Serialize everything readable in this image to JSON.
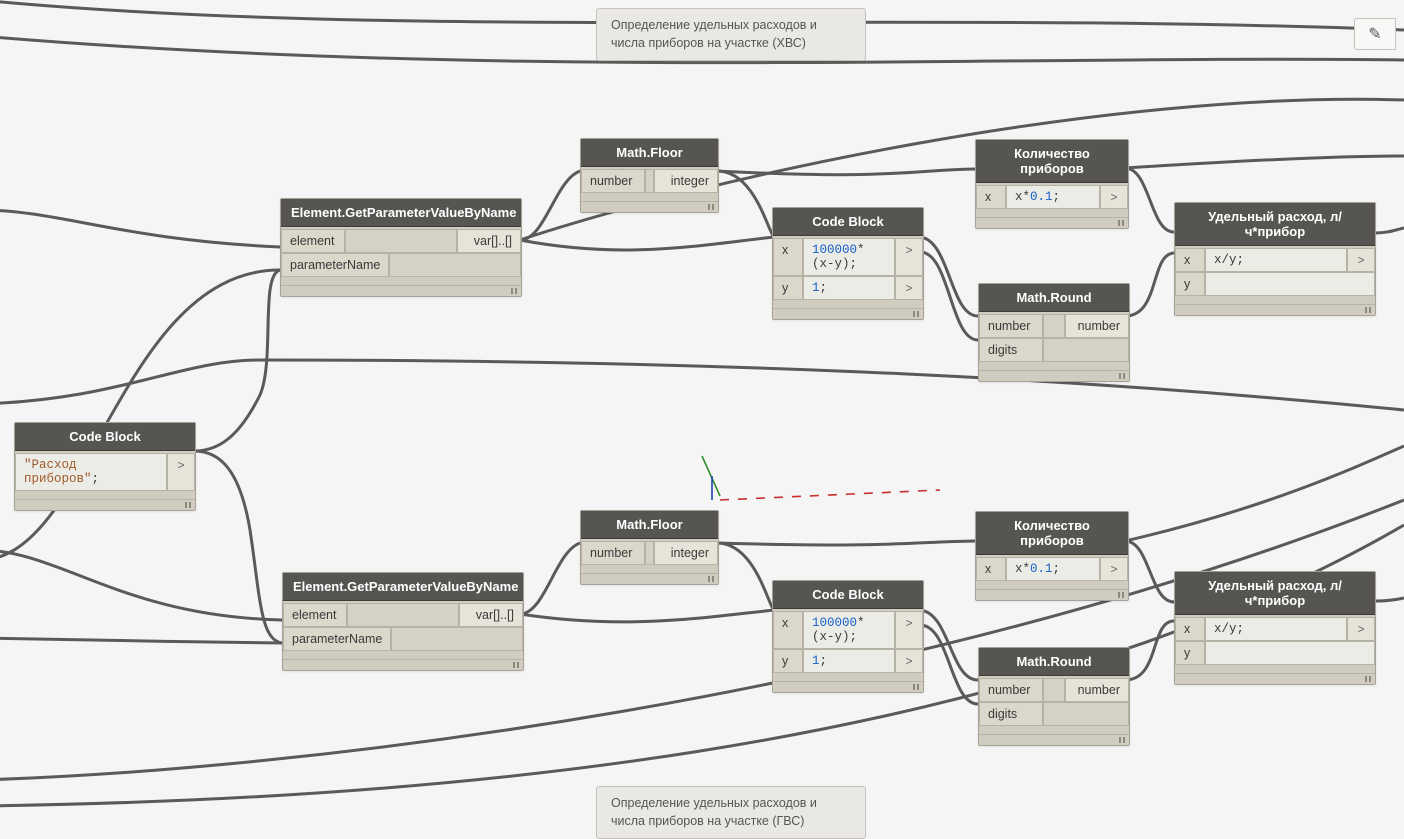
{
  "notes": {
    "top": "Определение удельных расходов и числа приборов на участке (ХВС)",
    "bottom": "Определение удельных расходов и числа приборов на участке (ГВС)"
  },
  "nodes": {
    "codeBlockLeft": {
      "title": "Code Block",
      "code_str": "\"Расход приборов\"",
      "semi": ";"
    },
    "getParam1": {
      "title": "Element.GetParameterValueByName",
      "in1": "element",
      "in2": "parameterName",
      "out": "var[]..[]"
    },
    "getParam2": {
      "title": "Element.GetParameterValueByName",
      "in1": "element",
      "in2": "parameterName",
      "out": "var[]..[]"
    },
    "mathFloor1": {
      "title": "Math.Floor",
      "in": "number",
      "out": "integer"
    },
    "mathFloor2": {
      "title": "Math.Floor",
      "in": "number",
      "out": "integer"
    },
    "codeMid1": {
      "title": "Code Block",
      "x": "x",
      "y": "y",
      "l1a": "100000",
      "l1b": "*(x-y);",
      "l2": "1",
      "l2b": ";"
    },
    "codeMid2": {
      "title": "Code Block",
      "x": "x",
      "y": "y",
      "l1a": "100000",
      "l1b": "*(x-y);",
      "l2": "1",
      "l2b": ";"
    },
    "count1": {
      "title": "Количество приборов",
      "x": "x",
      "code": "x*",
      "num": "0.1",
      "semi": ";"
    },
    "count2": {
      "title": "Количество приборов",
      "x": "x",
      "code": "x*",
      "num": "0.1",
      "semi": ";"
    },
    "round1": {
      "title": "Math.Round",
      "in1": "number",
      "in2": "digits",
      "out": "number"
    },
    "round2": {
      "title": "Math.Round",
      "in1": "number",
      "in2": "digits",
      "out": "number"
    },
    "ud1": {
      "title": "Удельный расход, л/ч*прибор",
      "x": "x",
      "y": "y",
      "code": "x/y;"
    },
    "ud2": {
      "title": "Удельный расход, л/ч*прибор",
      "x": "x",
      "y": "y",
      "code": "x/y;"
    }
  },
  "tool": "✎"
}
